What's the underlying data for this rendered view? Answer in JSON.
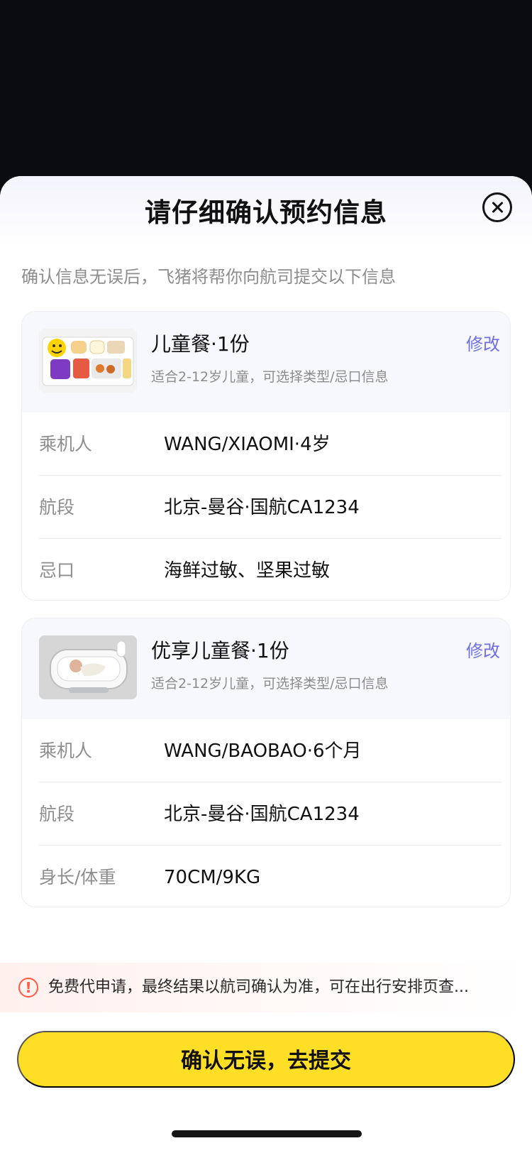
{
  "sheet": {
    "title": "请仔细确认预约信息",
    "subtitle": "确认信息无误后，飞猪将帮你向航司提交以下信息"
  },
  "cards": [
    {
      "title": "儿童餐·1份",
      "description": "适合2-12岁儿童，可选择类型/忌口信息",
      "edit_label": "修改",
      "image_icon": "kids-meal-image",
      "rows": [
        {
          "label": "乘机人",
          "value": "WANG/XIAOMI·4岁"
        },
        {
          "label": "航段",
          "value": "北京-曼谷·国航CA1234"
        },
        {
          "label": "忌口",
          "value": "海鲜过敏、坚果过敏"
        }
      ]
    },
    {
      "title": "优享儿童餐·1份",
      "description": "适合2-12岁儿童，可选择类型/忌口信息",
      "edit_label": "修改",
      "image_icon": "baby-bassinet-image",
      "rows": [
        {
          "label": "乘机人",
          "value": "WANG/BAOBAO·6个月"
        },
        {
          "label": "航段",
          "value": "北京-曼谷·国航CA1234"
        },
        {
          "label": "身长/体重",
          "value": "70CM/9KG"
        }
      ]
    }
  ],
  "notice": {
    "text": "免费代申请，最终结果以航司确认为准，可在出行安排页查..."
  },
  "actions": {
    "submit_label": "确认无误，去提交"
  },
  "icons": {
    "close": "close-icon",
    "notice": "warning-icon"
  },
  "colors": {
    "link": "#6f6fe5",
    "primary_button": "#ffdf26",
    "notice": "#ff5a43",
    "background": "#0b0c10"
  }
}
